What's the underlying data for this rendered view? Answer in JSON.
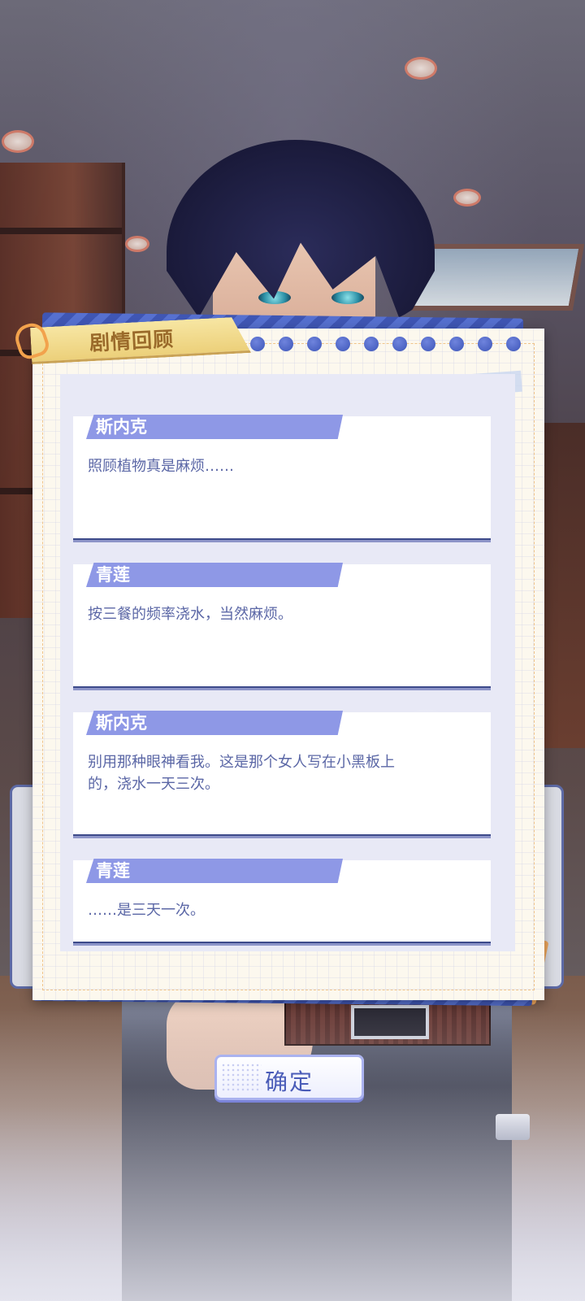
{
  "panel": {
    "title": "剧情回顾"
  },
  "dialogues": [
    {
      "speaker": "斯内克",
      "text": "照顾植物真是麻烦……"
    },
    {
      "speaker": "青莲",
      "text": "按三餐的频率浇水，当然麻烦。"
    },
    {
      "speaker": "斯内克",
      "text": "别用那种眼神看我。这是那个女人写在小黑板上的，浇水一天三次。"
    },
    {
      "speaker": "青莲",
      "text": "……是三天一次。"
    }
  ],
  "buttons": {
    "confirm_label": "确定"
  },
  "icons": {
    "clip": "paperclip-icon"
  },
  "colors": {
    "speaker_tag": "#8e98e6",
    "dialogue_text": "#5b67a6",
    "accent_blue": "#3d55b8",
    "title_tag": "#ecd07a"
  }
}
